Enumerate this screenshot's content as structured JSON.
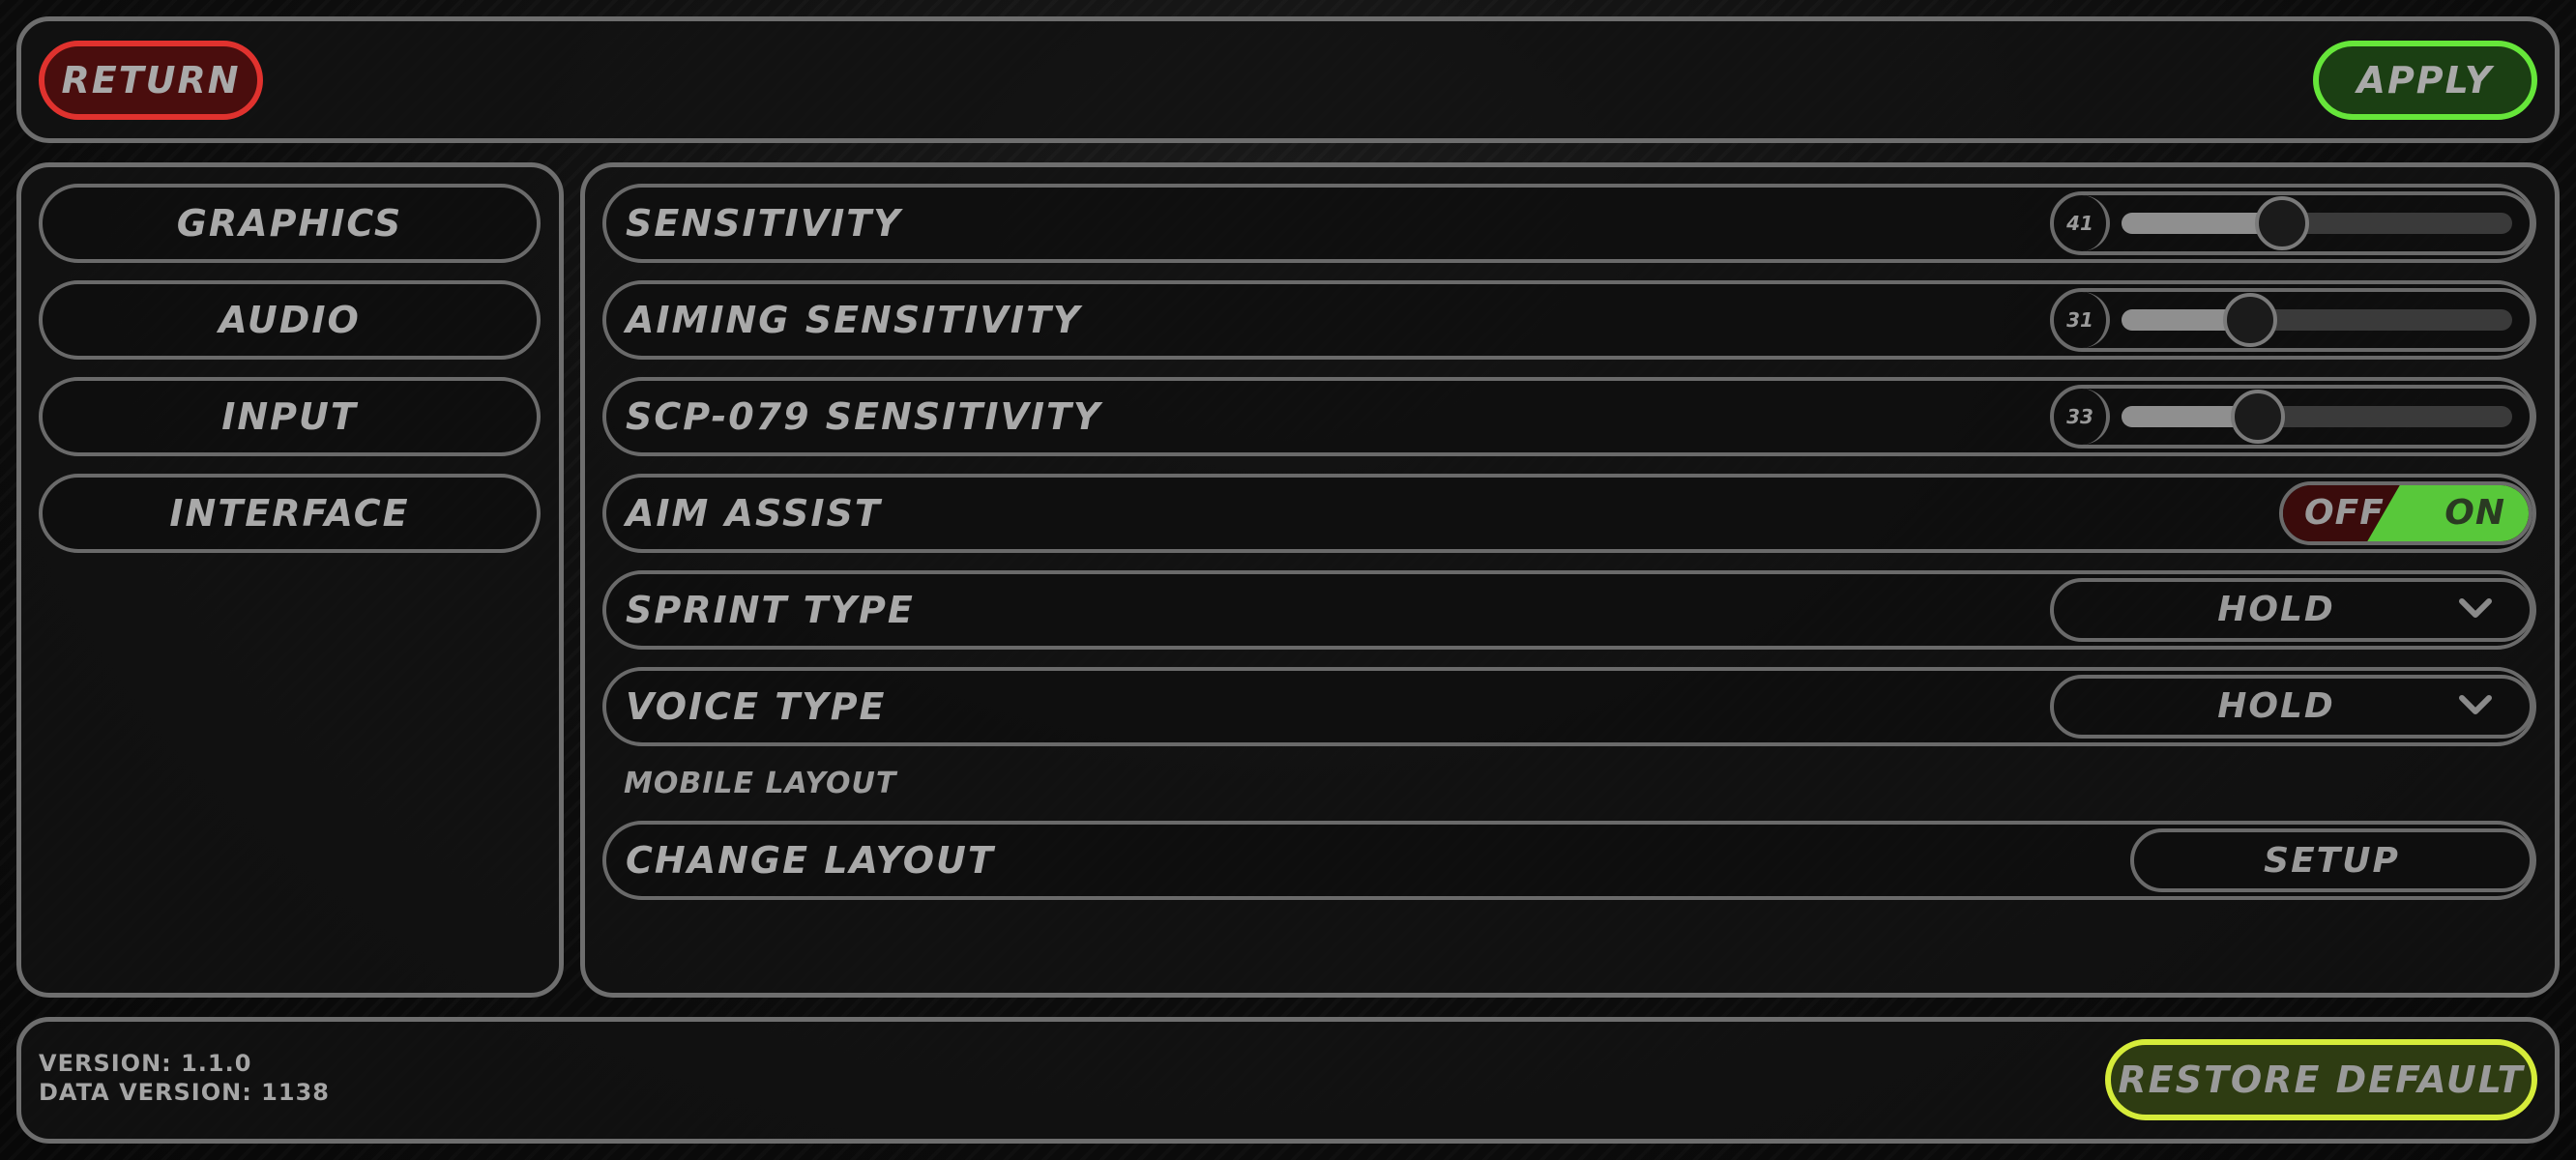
{
  "topbar": {
    "return_label": "RETURN",
    "apply_label": "APPLY"
  },
  "sidebar": {
    "items": [
      {
        "label": "GRAPHICS"
      },
      {
        "label": "AUDIO"
      },
      {
        "label": "INPUT"
      },
      {
        "label": "INTERFACE"
      }
    ]
  },
  "settings": {
    "sensitivity": {
      "label": "SENSITIVITY",
      "value": "41",
      "fraction": 0.41
    },
    "aiming_sensitivity": {
      "label": "AIMING SENSITIVITY",
      "value": "31",
      "fraction": 0.33
    },
    "scp079_sensitivity": {
      "label": "SCP-079 SENSITIVITY",
      "value": "33",
      "fraction": 0.35
    },
    "aim_assist": {
      "label": "AIM ASSIST",
      "off_label": "OFF",
      "on_label": "ON",
      "state": "ON"
    },
    "sprint_type": {
      "label": "SPRINT TYPE",
      "value": "HOLD"
    },
    "voice_type": {
      "label": "VOICE TYPE",
      "value": "HOLD"
    },
    "mobile_layout_header": "MOBILE LAYOUT",
    "change_layout": {
      "label": "CHANGE LAYOUT",
      "button_label": "SETUP"
    }
  },
  "footer": {
    "version": "VERSION: 1.1.0",
    "data_version": "DATA VERSION: 1138",
    "restore_label": "RESTORE DEFAULT"
  },
  "colors": {
    "return_border": "#e0322e",
    "apply_border": "#66e63a",
    "restore_border": "#d6ec3a",
    "toggle_on": "#58c83a",
    "toggle_off": "#3a0b0b"
  },
  "icons": {
    "dropdown": "chevron-down-icon"
  }
}
